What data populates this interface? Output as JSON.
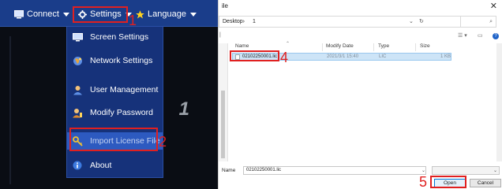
{
  "app": {
    "menu": {
      "connect_label": "Connect",
      "settings_label": "Settings",
      "language_label": "Language"
    },
    "background_text": ": 1",
    "dropdown": {
      "items": [
        {
          "label": "Screen Settings",
          "icon": "monitor-icon"
        },
        {
          "label": "Network Settings",
          "icon": "globe-icon"
        },
        {
          "label": "User Management",
          "icon": "user-icon"
        },
        {
          "label": "Modify Password",
          "icon": "user-key-icon"
        },
        {
          "label": "Import License File",
          "icon": "key-icon",
          "active": true
        },
        {
          "label": "About",
          "icon": "info-icon"
        }
      ]
    }
  },
  "annotations": {
    "step1": "1",
    "step2": "2",
    "step4": "4",
    "step5": "5",
    "color": "#e02020"
  },
  "dialog": {
    "title": "ile",
    "close": "✕",
    "address": {
      "location": "Desktop›",
      "path": "1"
    },
    "columns": [
      "Name",
      "Modify Date",
      "Type",
      "Size"
    ],
    "files": [
      {
        "name": "02102250001.lic",
        "modified": "2021/3/1 15:40",
        "type": "LIC",
        "size": "1 KB"
      }
    ],
    "file_name_label": "Name",
    "file_name_value": "02102250001.lic",
    "open_label": "Open",
    "cancel_label": "Cancel"
  },
  "colors": {
    "menubar": "#1a3d8a",
    "dropdown": "#16327a",
    "active_item": "#2d5ac0",
    "selection": "#cde4f7"
  }
}
